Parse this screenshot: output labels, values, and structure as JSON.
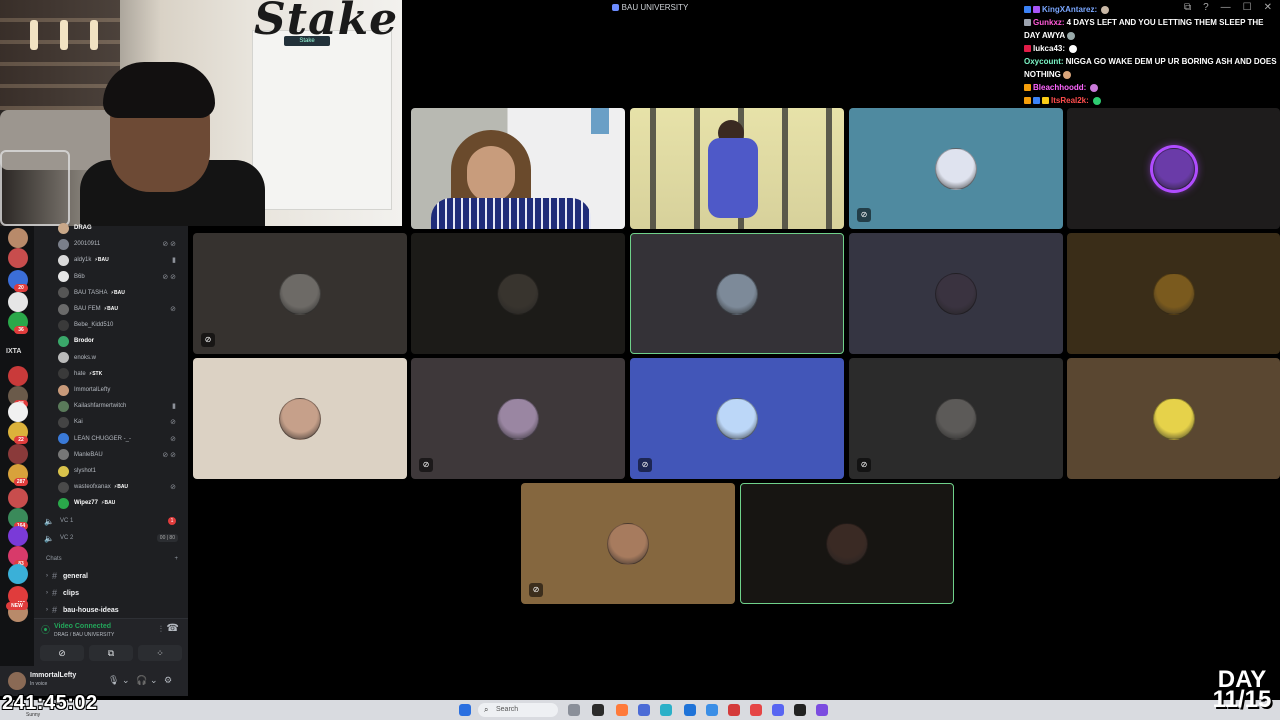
{
  "window": {
    "title": "BAU UNIVERSITY",
    "controls": [
      "⧉",
      "?",
      "—",
      "☐",
      "✕"
    ]
  },
  "webcam": {
    "brand_text": "Stake",
    "sticker_text": "Stake"
  },
  "chat": [
    {
      "user": "KingXAntarez:",
      "text": "",
      "user_color": "#7aa7ff",
      "badge_colors": [
        "#3b82f6",
        "#a855f7"
      ]
    },
    {
      "user": "Gunkxz:",
      "text": "4 DAYS LEFT AND YOU LETTING THEM SLEEP THE DAY AWYA",
      "user_color": "#ff5ad7",
      "badge_colors": [
        "#9ca3af"
      ]
    },
    {
      "user": "lukca43:",
      "text": "",
      "user_color": "#ffffff",
      "badge_colors": [
        "#e11d48"
      ]
    },
    {
      "user": "Oxycount:",
      "text": "NIGGA GO WAKE DEM UP UR BORING ASH AND DOES NOTHING",
      "user_color": "#7cf5c6",
      "badge_colors": []
    },
    {
      "user": "Bleachhoodd:",
      "text": "",
      "user_color": "#ff66ff",
      "badge_colors": [
        "#f59e0b"
      ]
    },
    {
      "user": "ItsReal2k:",
      "text": "",
      "user_color": "#ff4d4d",
      "badge_colors": [
        "#f59e0b",
        "#3b82f6",
        "#facc15"
      ]
    }
  ],
  "sidebar": {
    "server_label": "IXTA",
    "server_counts": [
      "20",
      "36",
      "28",
      "22",
      "287",
      "164",
      "83",
      "430"
    ],
    "members": [
      {
        "name": "DRAG",
        "tag": "",
        "bold": true,
        "icons": ""
      },
      {
        "name": "20010911",
        "tag": "",
        "bold": false,
        "icons": "⊘ ⊘"
      },
      {
        "name": "aldy1k",
        "tag": "⚡BAU",
        "bold": false,
        "icons": "▮"
      },
      {
        "name": "B6b",
        "tag": "",
        "bold": false,
        "icons": "⊘ ⊘"
      },
      {
        "name": "BAU TASHA",
        "tag": "⚡BAU",
        "bold": false,
        "icons": ""
      },
      {
        "name": "BAU FEM",
        "tag": "⚡BAU",
        "bold": false,
        "icons": "⊘"
      },
      {
        "name": "Bebe_Kidd510",
        "tag": "",
        "bold": false,
        "icons": ""
      },
      {
        "name": "Brodor",
        "tag": "",
        "bold": true,
        "icons": ""
      },
      {
        "name": "enoks.w",
        "tag": "",
        "bold": false,
        "icons": ""
      },
      {
        "name": "hate",
        "tag": "⚡STK",
        "bold": false,
        "icons": ""
      },
      {
        "name": "ImmortalLefty",
        "tag": "",
        "bold": false,
        "icons": ""
      },
      {
        "name": "Kailashfarmertwitch",
        "tag": "",
        "bold": false,
        "icons": "▮"
      },
      {
        "name": "Kai",
        "tag": "",
        "bold": false,
        "icons": "⊘"
      },
      {
        "name": "LEAN CHUGGER -_-",
        "tag": "",
        "bold": false,
        "icons": "⊘"
      },
      {
        "name": "ManleBAU",
        "tag": "",
        "bold": false,
        "icons": "⊘ ⊘"
      },
      {
        "name": "slyshot1",
        "tag": "",
        "bold": false,
        "icons": ""
      },
      {
        "name": "wasteofxanax",
        "tag": "⚡BAU",
        "bold": false,
        "icons": "⊘"
      },
      {
        "name": "Wipez77",
        "tag": "⚡BAU",
        "bold": true,
        "icons": ""
      }
    ],
    "voice_channels": [
      {
        "name": "VC 1",
        "pill": "1",
        "red": true
      },
      {
        "name": "VC 2",
        "pill": "00 | 80",
        "red": false
      }
    ],
    "category": {
      "name": "Chats",
      "plus": "+"
    },
    "channels": [
      {
        "name": "general"
      },
      {
        "name": "clips"
      },
      {
        "name": "bau-house-ideas"
      }
    ],
    "new_badge": "NEW"
  },
  "voice_panel": {
    "status": "Video Connected",
    "location": "DRAG / BAU UNIVERSITY",
    "buttons": [
      "⊘",
      "⧉",
      "⁘"
    ]
  },
  "user_panel": {
    "username": "ImmortalLefty",
    "status": "In voice"
  },
  "tiles": [
    {
      "id": "tile-1",
      "kind": "feed-a",
      "muted": false,
      "active": false
    },
    {
      "id": "tile-2",
      "kind": "feed-b",
      "muted": false,
      "active": false
    },
    {
      "id": "tile-3",
      "bg": "#4f8aa0",
      "avatar": "#dfe3ef",
      "muted": true,
      "active": false
    },
    {
      "id": "tile-4",
      "bg": "#1e1c1c",
      "avatar": "#6a3ba8",
      "muted": false,
      "active": false,
      "ring": true
    },
    {
      "id": "tile-5",
      "bg": "#36322f",
      "avatar": "#6d6a66",
      "muted": true,
      "active": false
    },
    {
      "id": "tile-6",
      "bg": "#1c1b18",
      "avatar": "#38342e",
      "muted": false,
      "active": false
    },
    {
      "id": "tile-7",
      "bg": "#343237",
      "avatar": "#7d8a99",
      "muted": false,
      "active": true
    },
    {
      "id": "tile-8",
      "bg": "#353542",
      "avatar": "#3a3340",
      "muted": false,
      "active": false
    },
    {
      "id": "tile-9",
      "bg": "#3a2d18",
      "avatar": "#7a5a1e",
      "muted": false,
      "active": false
    },
    {
      "id": "tile-10",
      "bg": "#dcd2c4",
      "avatar": "#c6a08a",
      "muted": false,
      "active": false
    },
    {
      "id": "tile-11",
      "bg": "#3e383a",
      "avatar": "#9a86a2",
      "muted": true,
      "active": false
    },
    {
      "id": "tile-12",
      "bg": "#4256b8",
      "avatar": "#bcd7f8",
      "muted": true,
      "active": false
    },
    {
      "id": "tile-13",
      "bg": "#2b2b2b",
      "avatar": "#5c5a58",
      "muted": true,
      "active": false
    },
    {
      "id": "tile-14",
      "bg": "#5a4731",
      "avatar": "#e6d24a",
      "muted": false,
      "active": false
    },
    {
      "id": "tile-15",
      "bg": "#85673f",
      "avatar": "#a77b5e",
      "muted": true,
      "active": false
    },
    {
      "id": "tile-16",
      "bg": "#171512",
      "avatar": "#3a2a24",
      "muted": false,
      "active": true
    }
  ],
  "taskbar": {
    "search_placeholder": "Search"
  },
  "overlay": {
    "timer": "241:45:02",
    "timer_sub": "Sunny",
    "day_label": "DAY",
    "day_count": "11/15"
  }
}
